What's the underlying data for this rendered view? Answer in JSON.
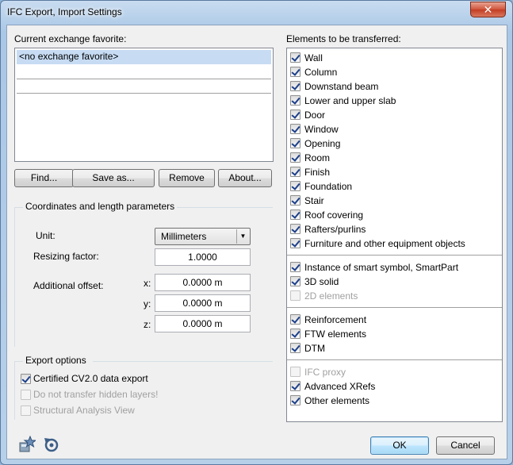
{
  "window": {
    "title": "IFC Export, Import Settings",
    "close_glyph": "✕"
  },
  "favorites": {
    "label": "Current exchange favorite:",
    "items": [
      "<no exchange favorite>",
      "",
      ""
    ],
    "buttons": {
      "find": "Find...",
      "save_as": "Save as...",
      "remove": "Remove",
      "about": "About..."
    }
  },
  "coords": {
    "group_label": "Coordinates and length parameters",
    "unit_label": "Unit:",
    "unit_value": "Millimeters",
    "resize_label": "Resizing factor:",
    "resize_value": "1.0000",
    "offset_label": "Additional offset:",
    "x_label": "x:",
    "x_value": "0.0000 m",
    "y_label": "y:",
    "y_value": "0.0000 m",
    "z_label": "z:",
    "z_value": "0.0000 m"
  },
  "export": {
    "group_label": "Export options",
    "options": [
      {
        "label": "Certified CV2.0 data export",
        "checked": true,
        "enabled": true
      },
      {
        "label": "Do not transfer hidden layers!",
        "checked": false,
        "enabled": false
      },
      {
        "label": "Structural Analysis View",
        "checked": false,
        "enabled": false
      }
    ]
  },
  "elements": {
    "label": "Elements to be transferred:",
    "groups": [
      [
        {
          "label": "Wall",
          "checked": true,
          "enabled": true
        },
        {
          "label": "Column",
          "checked": true,
          "enabled": true
        },
        {
          "label": "Downstand beam",
          "checked": true,
          "enabled": true
        },
        {
          "label": "Lower and upper slab",
          "checked": true,
          "enabled": true
        },
        {
          "label": "Door",
          "checked": true,
          "enabled": true
        },
        {
          "label": "Window",
          "checked": true,
          "enabled": true
        },
        {
          "label": "Opening",
          "checked": true,
          "enabled": true
        },
        {
          "label": "Room",
          "checked": true,
          "enabled": true
        },
        {
          "label": "Finish",
          "checked": true,
          "enabled": true
        },
        {
          "label": "Foundation",
          "checked": true,
          "enabled": true
        },
        {
          "label": "Stair",
          "checked": true,
          "enabled": true
        },
        {
          "label": "Roof covering",
          "checked": true,
          "enabled": true
        },
        {
          "label": "Rafters/purlins",
          "checked": true,
          "enabled": true
        },
        {
          "label": "Furniture and other equipment objects",
          "checked": true,
          "enabled": true
        }
      ],
      [
        {
          "label": "Instance of smart symbol, SmartPart",
          "checked": true,
          "enabled": true
        },
        {
          "label": "3D solid",
          "checked": true,
          "enabled": true
        },
        {
          "label": "2D elements",
          "checked": false,
          "enabled": false
        }
      ],
      [
        {
          "label": "Reinforcement",
          "checked": true,
          "enabled": true
        },
        {
          "label": "FTW elements",
          "checked": true,
          "enabled": true
        },
        {
          "label": "DTM",
          "checked": true,
          "enabled": true
        }
      ],
      [
        {
          "label": "IFC proxy",
          "checked": false,
          "enabled": false
        },
        {
          "label": "Advanced XRefs",
          "checked": true,
          "enabled": true
        },
        {
          "label": "Other elements",
          "checked": true,
          "enabled": true
        }
      ]
    ]
  },
  "footer": {
    "ok": "OK",
    "cancel": "Cancel",
    "icons": [
      "favorite-star-icon",
      "reset-icon"
    ]
  },
  "colors": {
    "selection": "#c7dcf3",
    "accent": "#3c7fb1",
    "close": "#c23d23"
  }
}
